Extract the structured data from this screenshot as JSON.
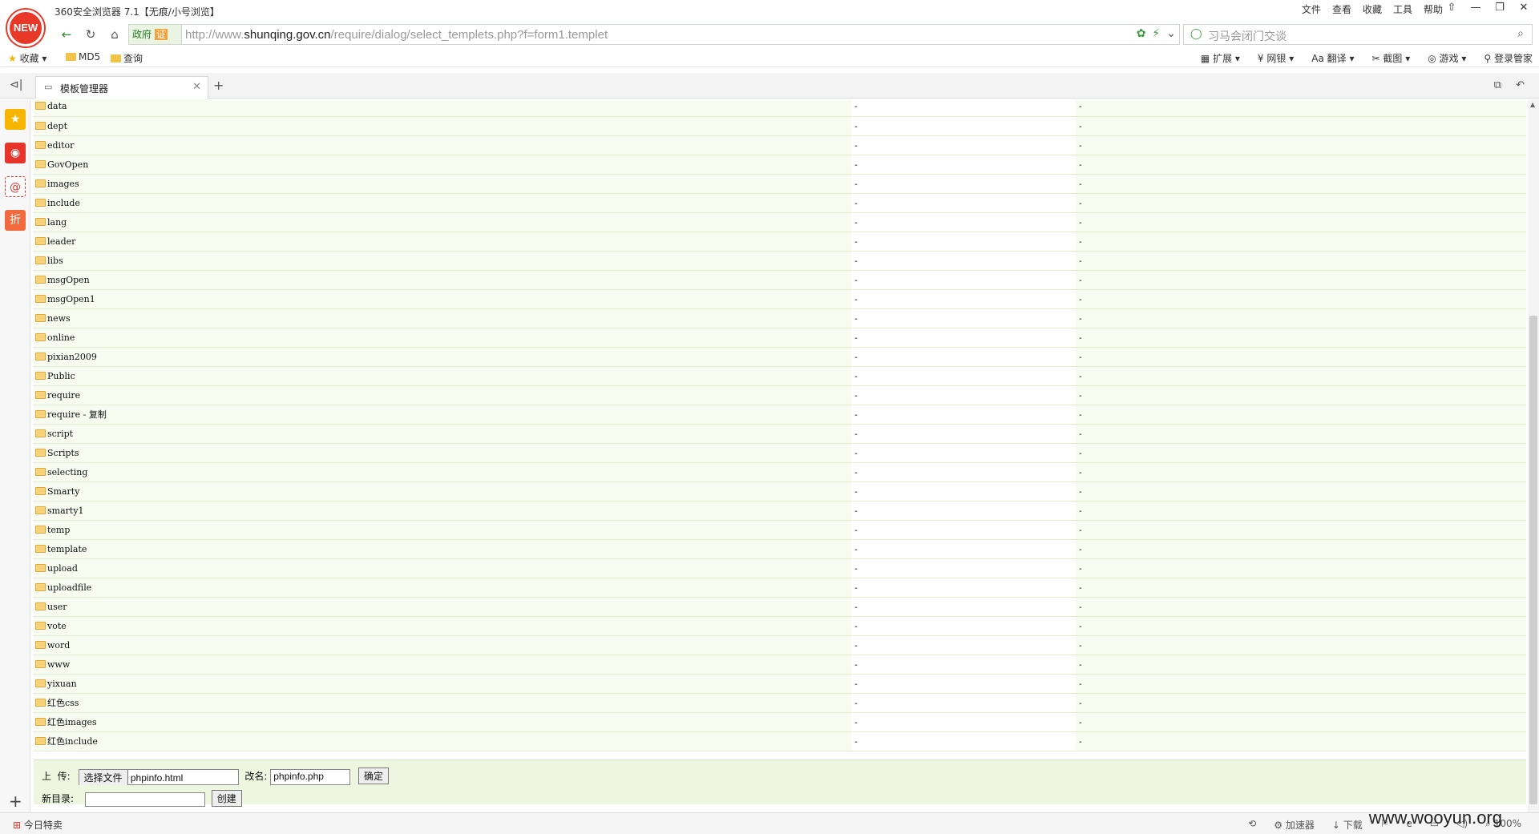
{
  "browser": {
    "logo_text": "NEW",
    "window_title": "360安全浏览器 7.1【无痕/小号浏览】",
    "menu": [
      "文件",
      "查看",
      "收藏",
      "工具",
      "帮助"
    ],
    "win_buttons": [
      "⇧",
      "—",
      "❐",
      "✕"
    ]
  },
  "address": {
    "gov_label": "政府",
    "cert_label": "证",
    "url_prefix": "http://www.",
    "url_domain": "shunqing.gov.cn",
    "url_path": "/require/dialog/select_templets.php?f=form1.templet",
    "search_placeholder": "习马会闭门交谈"
  },
  "bookmarks": {
    "items": [
      "收藏",
      "MD5",
      "查询"
    ],
    "right": [
      "扩展",
      "网银",
      "翻译",
      "截图",
      "游戏",
      "登录管家"
    ]
  },
  "tab": {
    "title": "模板管理器"
  },
  "files": [
    "data",
    "dept",
    "editor",
    "GovOpen",
    "images",
    "include",
    "lang",
    "leader",
    "libs",
    "msgOpen",
    "msgOpen1",
    "news",
    "online",
    "pixian2009",
    "Public",
    "require",
    "require - 复制",
    "script",
    "Scripts",
    "selecting",
    "Smarty",
    "smarty1",
    "temp",
    "template",
    "upload",
    "uploadfile",
    "user",
    "vote",
    "word",
    "www",
    "yixuan",
    "红色css",
    "红色images",
    "红色include"
  ],
  "dash": "-",
  "upload": {
    "label": "上  传:",
    "choose_button": "选择文件",
    "chosen_file": "phpinfo.html",
    "rename_label": "改名:",
    "rename_value": "phpinfo.php",
    "confirm_button": "确定",
    "newdir_label": "新目录:",
    "newdir_value": "",
    "create_button": "创建"
  },
  "status": {
    "left": "今日特卖",
    "items": [
      "加速器",
      "下载",
      "100%"
    ],
    "watermark": "www.wooyun.org"
  },
  "colors": {
    "accent_green": "#3a9a3a",
    "row_bg": "#f8fbef",
    "logo_red": "#e83828"
  }
}
